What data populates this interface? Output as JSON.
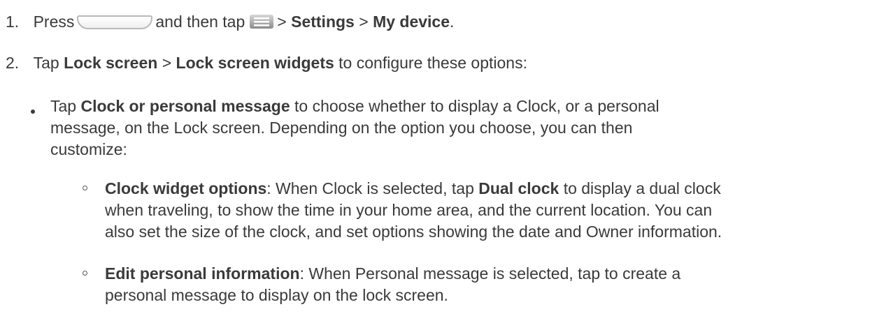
{
  "step1": {
    "number": "1.",
    "press": "Press",
    "home_key_icon": "home-key-icon",
    "and_then_tap": "and then tap",
    "menu_key_icon": "menu-key-icon",
    "sep1": ">",
    "settings": "Settings",
    "sep2": ">",
    "my_device": "My device",
    "end": "."
  },
  "step2": {
    "number": "2.",
    "tap": "Tap",
    "lock_screen": "Lock screen",
    "sep": ">",
    "lock_screen_widgets": "Lock screen widgets",
    "rest": "to configure these options:"
  },
  "bullet": {
    "tap": "Tap",
    "title": "Clock or personal message",
    "line1_rest": "to choose whether to display a Clock, or a personal",
    "line2": "message, on the Lock screen. Depending on the option you choose, you can then",
    "line3": "customize:"
  },
  "sub1": {
    "title": "Clock widget options",
    "line1_a": ": When Clock is selected, tap",
    "dual_clock": "Dual clock",
    "line1_b": "to display a dual clock",
    "line2": "when traveling, to show the time in your home area, and the current location. You can",
    "line3": "also set the size of the clock, and set options showing the date and Owner information."
  },
  "sub2": {
    "title": "Edit personal information",
    "line1_rest": ": When Personal message is selected, tap to create a",
    "line2": "personal message to display on the lock screen."
  }
}
